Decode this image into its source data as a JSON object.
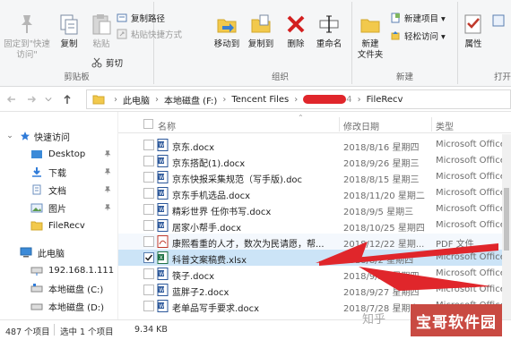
{
  "ribbon": {
    "pin_label": "固定到\"快速访问\"",
    "copy_label": "复制",
    "paste_label": "粘贴",
    "copy_path_label": "复制路径",
    "paste_shortcut_label": "粘贴快捷方式",
    "cut_label": "剪切",
    "clipboard_group": "剪贴板",
    "move_to_label": "移动到",
    "copy_to_label": "复制到",
    "delete_label": "删除",
    "rename_label": "重命名",
    "organize_group": "组织",
    "new_folder_label": "新建\n文件夹",
    "new_item_label": "新建项目 ▾",
    "easy_access_label": "轻松访问 ▾",
    "new_group": "新建",
    "properties_label": "属性",
    "open_group": "打开"
  },
  "address": {
    "crumbs": [
      "此电脑",
      "本地磁盘 (F:)",
      "Tencent Files",
      "FileRecv"
    ],
    "redacted_suffix": "4"
  },
  "nav": {
    "items": [
      {
        "label": "快速访问",
        "icon": "star-icon"
      },
      {
        "label": "Desktop",
        "icon": "desktop-folder-icon"
      },
      {
        "label": "下载",
        "icon": "download-folder-icon"
      },
      {
        "label": "文档",
        "icon": "documents-folder-icon"
      },
      {
        "label": "图片",
        "icon": "pictures-folder-icon"
      },
      {
        "label": "FileRecv",
        "icon": "folder-icon"
      },
      {
        "label": "此电脑",
        "icon": "computer-icon"
      },
      {
        "label": "192.168.1.111",
        "icon": "network-drive-icon"
      },
      {
        "label": "本地磁盘 (C:)",
        "icon": "drive-icon"
      },
      {
        "label": "本地磁盘 (D:)",
        "icon": "drive-icon"
      }
    ]
  },
  "columns": {
    "name": "名称",
    "date": "修改日期",
    "type": "类型"
  },
  "files": [
    {
      "name": "京东.docx",
      "date": "2018/8/16 星期四",
      "type": "Microsoft Office...",
      "kind": "word",
      "checked": false
    },
    {
      "name": "京东搭配(1).docx",
      "date": "2018/9/26 星期三",
      "type": "Microsoft Office...",
      "kind": "word",
      "checked": false
    },
    {
      "name": "京东快报采集规范（写手版).doc",
      "date": "2018/8/15 星期三",
      "type": "Microsoft Office...",
      "kind": "word",
      "checked": false
    },
    {
      "name": "京东手机选品.docx",
      "date": "2018/11/20 星期二",
      "type": "Microsoft Office...",
      "kind": "word",
      "checked": false
    },
    {
      "name": "精彩世界 任你书写.docx",
      "date": "2018/9/5 星期三",
      "type": "Microsoft Office...",
      "kind": "word",
      "checked": false
    },
    {
      "name": "居家小帮手.docx",
      "date": "2018/10/25 星期四",
      "type": "Microsoft Office...",
      "kind": "word",
      "checked": false
    },
    {
      "name": "康熙看重的人才，数次为民请愿，帮...",
      "date": "2018/12/22 星期...",
      "type": "PDF 文件",
      "kind": "pdf",
      "checked": false
    },
    {
      "name": "科普文案稿费.xlsx",
      "date": "2018/8/2 星期四",
      "type": "Microsoft Office...",
      "kind": "excel",
      "checked": true
    },
    {
      "name": "筷子.docx",
      "date": "2018/9/20 星期四",
      "type": "Microsoft Office...",
      "kind": "word",
      "checked": false
    },
    {
      "name": "蓝胖子2.docx",
      "date": "2018/9/27 星期四",
      "type": "Microsoft Office...",
      "kind": "word",
      "checked": false
    },
    {
      "name": "老单品写手要求.docx",
      "date": "2018/7/28 星期六",
      "type": "Microsoft Office...",
      "kind": "word",
      "checked": false
    }
  ],
  "status": {
    "count": "487 个项目",
    "selected": "选中 1 个项目",
    "size": "9.34 KB"
  },
  "watermark": {
    "text": "宝哥软件园",
    "faint": "知乎"
  },
  "colors": {
    "accent": "#1a73c9",
    "selection": "#e5f1fb",
    "checked_row": "#cce4f7",
    "arrow": "#e0262b"
  }
}
